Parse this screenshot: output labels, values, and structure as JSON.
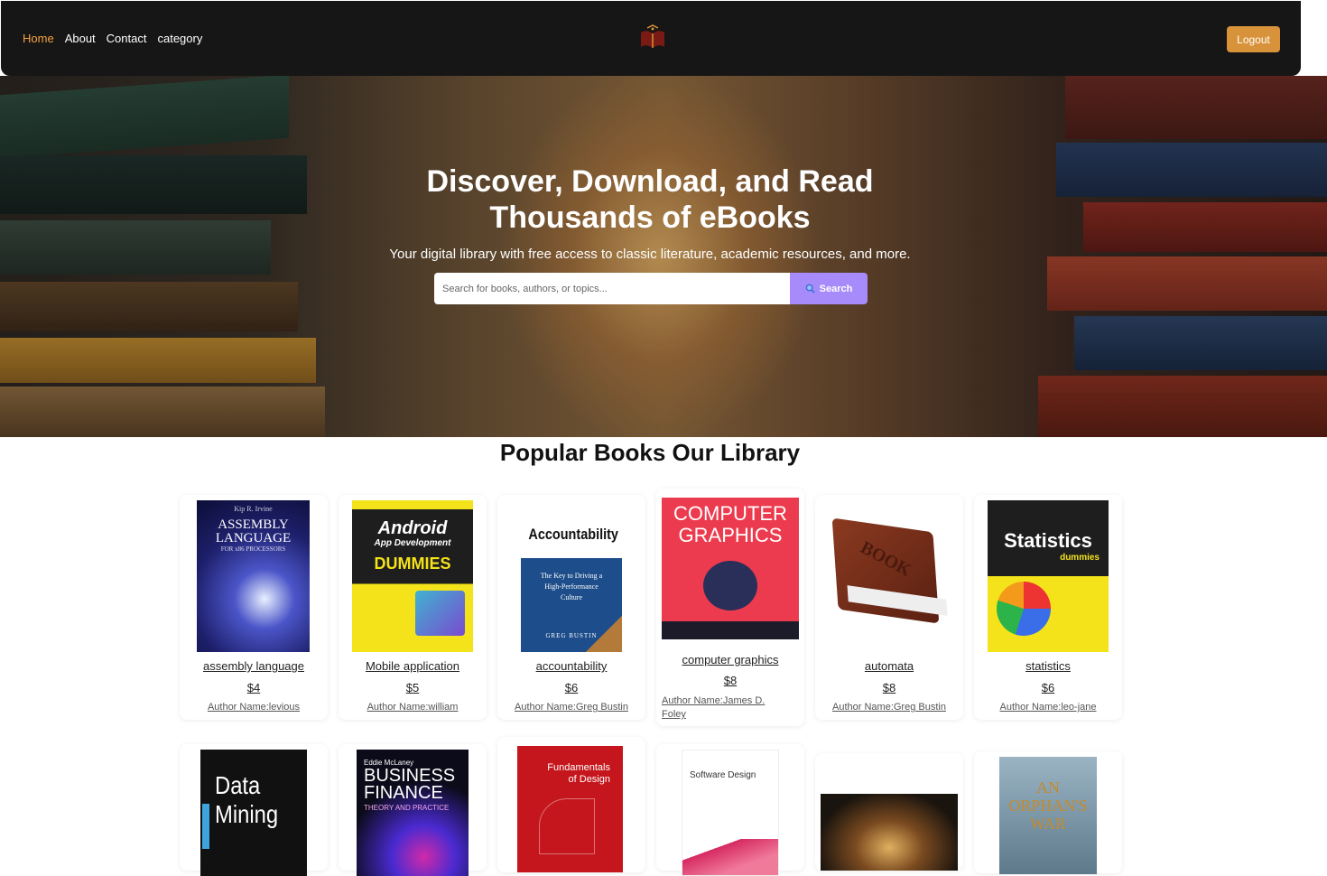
{
  "nav": {
    "links": [
      "Home",
      "About",
      "Contact",
      "category"
    ],
    "logout": "Logout"
  },
  "hero": {
    "title_line1": "Discover, Download, and Read",
    "title_line2": "Thousands of eBooks",
    "subtitle": "Your digital library with free access to classic literature, academic resources, and more.",
    "search_placeholder": "Search for books, authors, or topics...",
    "search_button": "Search"
  },
  "section": {
    "title": "Popular Books Our Library"
  },
  "books": [
    {
      "title": "assembly language",
      "price": "$4",
      "author": "Author Name:levious",
      "cover_top": "Kip R. Irvine",
      "cover_title": "ASSEMBLY LANGUAGE",
      "cover_sub": "FOR x86 PROCESSORS"
    },
    {
      "title": "Mobile application",
      "price": "$5",
      "author": "Author Name:william",
      "cover_title": "Android",
      "cover_sub": "App Development",
      "cover_brand": "DUMMIES"
    },
    {
      "title": "accountability",
      "price": "$6",
      "author": "Author Name:Greg Bustin",
      "cover_title": "Accountability",
      "cover_sub": "The Key to Driving a High-Performance Culture",
      "cover_author": "GREG BUSTIN"
    },
    {
      "title": "computer graphics",
      "price": "$8",
      "author": "Author Name:James D. Foley",
      "cover_title": "COMPUTER GRAPHICS"
    },
    {
      "title": "automata",
      "price": "$8",
      "author": "Author Name:Greg Bustin",
      "cover_title": "BOOK"
    },
    {
      "title": "statistics",
      "price": "$6",
      "author": "Author Name:leo-jane",
      "cover_title": "Statistics",
      "cover_brand": "dummies"
    },
    {
      "cover_title": "Data Mining"
    },
    {
      "cover_top": "Eddie McLaney",
      "cover_title": "BUSINESS FINANCE",
      "cover_sub": "THEORY AND PRACTICE"
    },
    {
      "cover_title": "Fundamentals of Design"
    },
    {
      "cover_title": "Software Design"
    },
    {
      "cover_title": ""
    },
    {
      "cover_title": "AN ORPHAN'S WAR"
    }
  ],
  "colors": {
    "nav_bg": "#161616",
    "accent": "#f4a441",
    "logout": "#d8923a",
    "search_button": "#a78bfa"
  }
}
